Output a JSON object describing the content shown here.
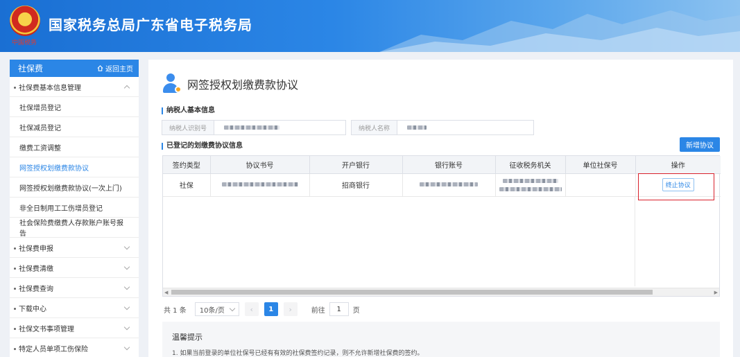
{
  "header": {
    "site_title": "国家税务总局广东省电子税务局",
    "emblem_text": "中国税务",
    "emblem_icon": "tax-emblem-icon"
  },
  "sidebar": {
    "head_label": "社保费",
    "home_label": "返回主页",
    "items": [
      {
        "label": "社保费基本信息管理",
        "expanded": true
      },
      {
        "label": "社保增员登记"
      },
      {
        "label": "社保减员登记"
      },
      {
        "label": "缴费工资调整"
      },
      {
        "label": "网签授权划缴费款协议",
        "active": true
      },
      {
        "label": "网签授权划缴费款协议(一次上门)"
      },
      {
        "label": "非全日制用工工伤增员登记"
      },
      {
        "label": "社会保险费缴费人存款账户账号报告"
      },
      {
        "label": "社保费申报"
      },
      {
        "label": "社保费清缴"
      },
      {
        "label": "社保费查询"
      },
      {
        "label": "下载中心"
      },
      {
        "label": "社保文书事项管理"
      },
      {
        "label": "特定人员单项工伤保险"
      }
    ]
  },
  "main": {
    "title": "网签授权划缴费款协议",
    "taxpayer_section": "纳税人基本信息",
    "taxpayer_id_label": "纳税人识别号",
    "taxpayer_name_label": "纳税人名称",
    "agreement_section": "已登记的划缴费协议信息",
    "add_button": "新增协议",
    "table": {
      "headers": [
        "签约类型",
        "协议书号",
        "开户银行",
        "银行账号",
        "征收税务机关",
        "单位社保号",
        "操作"
      ],
      "rows": [
        {
          "type": "社保",
          "bank": "招商银行",
          "action": "终止协议"
        }
      ]
    },
    "pager": {
      "total": "共 1 条",
      "page_size": "10条/页",
      "current_page": "1",
      "goto_label": "前往",
      "goto_value": "1",
      "page_unit": "页"
    },
    "tips": {
      "title": "温馨提示",
      "line1": "1. 如果当前登录的单位社保号已经有有效的社保费签约记录，则不允许新增社保费的签约。"
    }
  },
  "colors": {
    "primary": "#2b86e6",
    "highlight": "#d9202b"
  }
}
